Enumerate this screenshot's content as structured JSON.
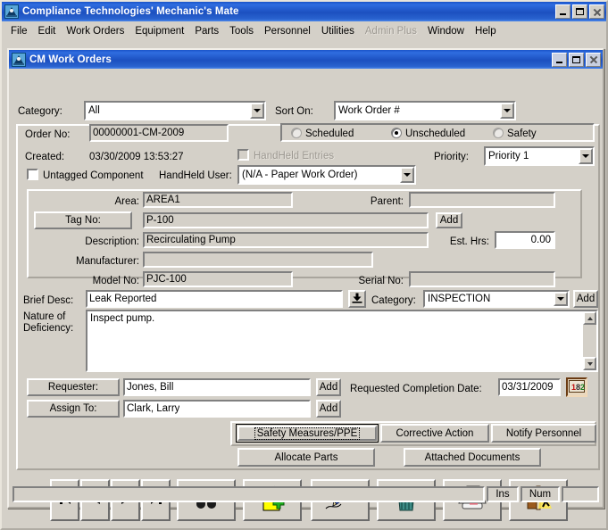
{
  "app": {
    "title": "Compliance Technologies' Mechanic's Mate",
    "icon": "app-icon",
    "minimize": "-",
    "maximize": "□",
    "close": "×"
  },
  "menu": {
    "items": [
      {
        "label": "File",
        "disabled": false
      },
      {
        "label": "Edit",
        "disabled": false
      },
      {
        "label": "Work Orders",
        "disabled": false
      },
      {
        "label": "Equipment",
        "disabled": false
      },
      {
        "label": "Parts",
        "disabled": false
      },
      {
        "label": "Tools",
        "disabled": false
      },
      {
        "label": "Personnel",
        "disabled": false
      },
      {
        "label": "Utilities",
        "disabled": false
      },
      {
        "label": "Admin Plus",
        "disabled": true
      },
      {
        "label": "Window",
        "disabled": false
      },
      {
        "label": "Help",
        "disabled": false
      }
    ]
  },
  "child_window": {
    "title": "CM Work Orders",
    "icon": "app-icon"
  },
  "filter": {
    "category_label": "Category:",
    "category_value": "All",
    "sort_label": "Sort On:",
    "sort_value": "Work Order #"
  },
  "order": {
    "order_no_label": "Order No:",
    "order_no_value": "00000001-CM-2009",
    "created_label": "Created:",
    "created_value": "03/30/2009  13:53:27",
    "untagged_label": "Untagged Component",
    "untagged_checked": false,
    "handheld_entries_label": "HandHeld Entries",
    "handheld_entries_checked": false,
    "handheld_user_label": "HandHeld User:",
    "handheld_user_value": "(N/A - Paper Work Order)",
    "priority_label": "Priority:",
    "priority_value": "Priority 1",
    "type_options": [
      {
        "label": "Scheduled",
        "selected": false
      },
      {
        "label": "Unscheduled",
        "selected": true
      },
      {
        "label": "Safety",
        "selected": false
      }
    ]
  },
  "equipment": {
    "area_label": "Area:",
    "area_value": "AREA1",
    "parent_label": "Parent:",
    "parent_value": "",
    "tag_no_label": "Tag No:",
    "tag_no_value": "P-100",
    "tag_add_label": "Add",
    "description_label": "Description:",
    "description_value": "Recirculating Pump",
    "est_hrs_label": "Est. Hrs:",
    "est_hrs_value": "0.00",
    "manufacturer_label": "Manufacturer:",
    "manufacturer_value": "",
    "model_no_label": "Model No:",
    "model_no_value": "PJC-100",
    "serial_no_label": "Serial No:",
    "serial_no_value": ""
  },
  "details": {
    "brief_desc_label": "Brief Desc:",
    "brief_desc_value": "Leak Reported",
    "brief_desc_picker_icon": "download-tray-icon",
    "category_label": "Category:",
    "category_value": "INSPECTION",
    "category_add_label": "Add",
    "nature_label_line1": "Nature of",
    "nature_label_line2": "Deficiency:",
    "nature_value": "Inspect pump."
  },
  "people": {
    "requester_label": "Requester:",
    "requester_value": "Jones, Bill",
    "requester_add_label": "Add",
    "assign_to_label": "Assign To:",
    "assign_to_value": "Clark, Larry",
    "assign_add_label": "Add",
    "completion_date_label": "Requested Completion Date:",
    "completion_date_value": "03/31/2009",
    "calendar_icon": "calendar-icon"
  },
  "actions": {
    "safety_measures": "Safety Measures/PPE",
    "corrective_action": "Corrective Action",
    "notify_personnel": "Notify Personnel",
    "allocate_parts": "Allocate Parts",
    "attached_documents": "Attached Documents"
  },
  "navbar": {
    "buttons": [
      {
        "name": "first-record-button",
        "icon": "first-record-icon"
      },
      {
        "name": "previous-record-button",
        "icon": "previous-record-icon"
      },
      {
        "name": "next-record-button",
        "icon": "next-record-icon"
      },
      {
        "name": "last-record-button",
        "icon": "last-record-icon"
      },
      {
        "name": "find-button",
        "icon": "binoculars-icon"
      },
      {
        "name": "new-record-button",
        "icon": "new-document-icon"
      },
      {
        "name": "edit-record-button",
        "icon": "pen-icon"
      },
      {
        "name": "delete-record-button",
        "icon": "trash-icon"
      },
      {
        "name": "print-button",
        "icon": "printer-icon"
      },
      {
        "name": "exit-button",
        "icon": "exit-door-icon"
      }
    ]
  },
  "statusbar": {
    "message": "",
    "ins": "Ins",
    "num": "Num",
    "extra": ""
  },
  "colors": {
    "titlebar_blue": "#1c50c0",
    "face": "#d4d0c8",
    "field_gray": "#d4d0c8",
    "text": "#000000",
    "disabled_text": "#9a968f"
  }
}
